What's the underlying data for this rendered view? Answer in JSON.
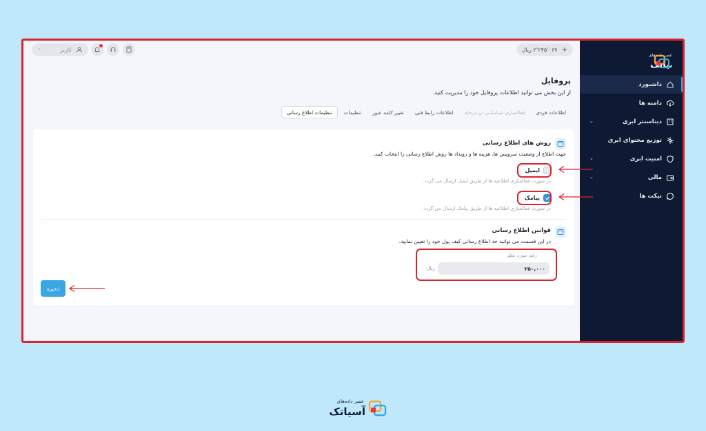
{
  "colors": {
    "accent": "#3aa6e2",
    "sidebar": "#0e1a33",
    "annotation": "#d9242b",
    "background": "#bfe9fb"
  },
  "brand": {
    "tagline": "عصر داده‌های",
    "name": "آسیاتک"
  },
  "sidebar": {
    "items": [
      {
        "label": "داشبورد",
        "icon": "home-icon",
        "active": true
      },
      {
        "label": "دامنه ها",
        "icon": "cloud-download-icon"
      },
      {
        "label": "دیتاسنتر ابری",
        "icon": "building-icon",
        "expandable": true
      },
      {
        "label": "توزیع محتوای ابری",
        "icon": "network-icon"
      },
      {
        "label": "امنیت ابری",
        "icon": "shield-icon",
        "expandable": true
      },
      {
        "label": "مالی",
        "icon": "wallet-icon",
        "expandable": true
      },
      {
        "label": "تیکت ها",
        "icon": "chat-icon"
      }
    ]
  },
  "topbar": {
    "wallet_amount": "۲٬۲۴۵٬۰۶۷ ریال",
    "wallet_add": "+",
    "user_label": "کاربر",
    "icons": [
      "user-icon",
      "notification-bell-icon",
      "headset-icon",
      "calculator-icon"
    ]
  },
  "page": {
    "title": "پروفایل",
    "subtitle": "از این بخش می توانید اطلاعات پروفایل خود را مدیریت کنید.",
    "tabs": [
      {
        "label": "اطلاعات فردی"
      },
      {
        "label": "فعالسازی شناسایی دو مرحله",
        "disabled": true
      },
      {
        "label": "اطلاعات رابط فنی"
      },
      {
        "label": "تغییر کلمه عبور"
      },
      {
        "label": "تنظیمات"
      },
      {
        "label": "تنظیمات اطلاع رسانی",
        "active": true
      }
    ]
  },
  "notify_methods": {
    "title": "روش های اطلاع رسانی",
    "description": "جهت اطلاع از وضعیت سرویس ها، هزینه ها و رویداد ها روش اطلاع رسانی را انتخاب کنید.",
    "options": [
      {
        "label": "ایمیل",
        "checked": false,
        "hint": "در صورت فعالسازی اطلاعیه ها از طریق ایمیل ارسال می گردد."
      },
      {
        "label": "پیامک",
        "checked": true,
        "hint": "در صورت فعالسازی اطلاعیه ها از طریق پیامک ارسال می گردد."
      }
    ]
  },
  "notify_rules": {
    "title": "قوانین اطلاع رسانی",
    "description": "در این قسمت می توانید حد اطلاع رسانی کیف پول خود را تعیین نمایید.",
    "field_label": "رقم مورد نظر",
    "amount_value": "۲۵۰,۰۰۰",
    "unit": "ریال"
  },
  "actions": {
    "save_label": "ذخیره"
  }
}
